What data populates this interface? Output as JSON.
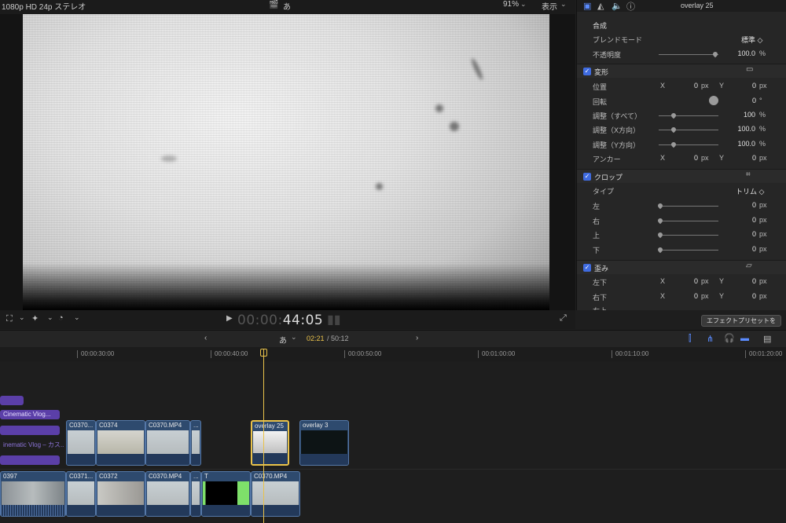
{
  "viewer": {
    "format_label": "1080p HD 24p ステレオ",
    "center_label": "あ",
    "zoom": "91%",
    "view_label": "表示",
    "timecode_dim": "00:00:",
    "timecode": "44:05"
  },
  "inspector": {
    "clip_name": "overlay 25",
    "composite": {
      "title": "合成",
      "blend_label": "ブレンドモード",
      "blend_value": "標準 ◇",
      "opacity_label": "不透明度",
      "opacity_value": "100.0",
      "opacity_unit": "%"
    },
    "transform": {
      "title": "変形",
      "position_label": "位置",
      "x": "X",
      "y": "Y",
      "pos_x": "0",
      "pos_y": "0",
      "px": "px",
      "rotation_label": "回転",
      "rotation_value": "0",
      "degree": "°",
      "scale_all_label": "調整（すべて）",
      "scale_all_value": "100",
      "scale_x_label": "調整（X方向）",
      "scale_x_value": "100.0",
      "scale_y_label": "調整（Y方向）",
      "scale_y_value": "100.0",
      "percent": "%",
      "anchor_label": "アンカー",
      "anchor_x": "0",
      "anchor_y": "0"
    },
    "crop": {
      "title": "クロップ",
      "type_label": "タイプ",
      "type_value": "トリム ◇",
      "left_label": "左",
      "left_value": "0",
      "right_label": "右",
      "right_value": "0",
      "top_label": "上",
      "top_value": "0",
      "bottom_label": "下",
      "bottom_value": "0",
      "px": "px"
    },
    "distort": {
      "title": "歪み",
      "bl_label": "左下",
      "bl_x": "0",
      "bl_y": "0",
      "br_label": "右下",
      "br_x": "0",
      "br_y": "0",
      "tr_label": "右上",
      "px": "px"
    },
    "preset_button": "エフェクトプリセットを"
  },
  "timeline": {
    "index_label": "あ",
    "position": "02:21",
    "duration": "/ 50:12",
    "ruler": [
      "00:00:30:00",
      "00:00:40:00",
      "00:00:50:00",
      "00:01:00:00",
      "00:01:10:00",
      "00:01:20:00"
    ],
    "upper_clips": [
      "C0370...",
      "C0374",
      "C0370.MP4",
      "...",
      "overlay 25",
      "overlay 3"
    ],
    "lower_clips": [
      "0397",
      "C0371...",
      "C0372",
      "C0370.MP4",
      "...",
      "T",
      "C0370.MP4"
    ],
    "titles": [
      "Cinematic Vlog...",
      "inematic Vlog – カス..."
    ]
  },
  "colors": {
    "accent": "#e9c24a",
    "selection": "#5b8cff",
    "title_purple": "#5b3fa8"
  }
}
